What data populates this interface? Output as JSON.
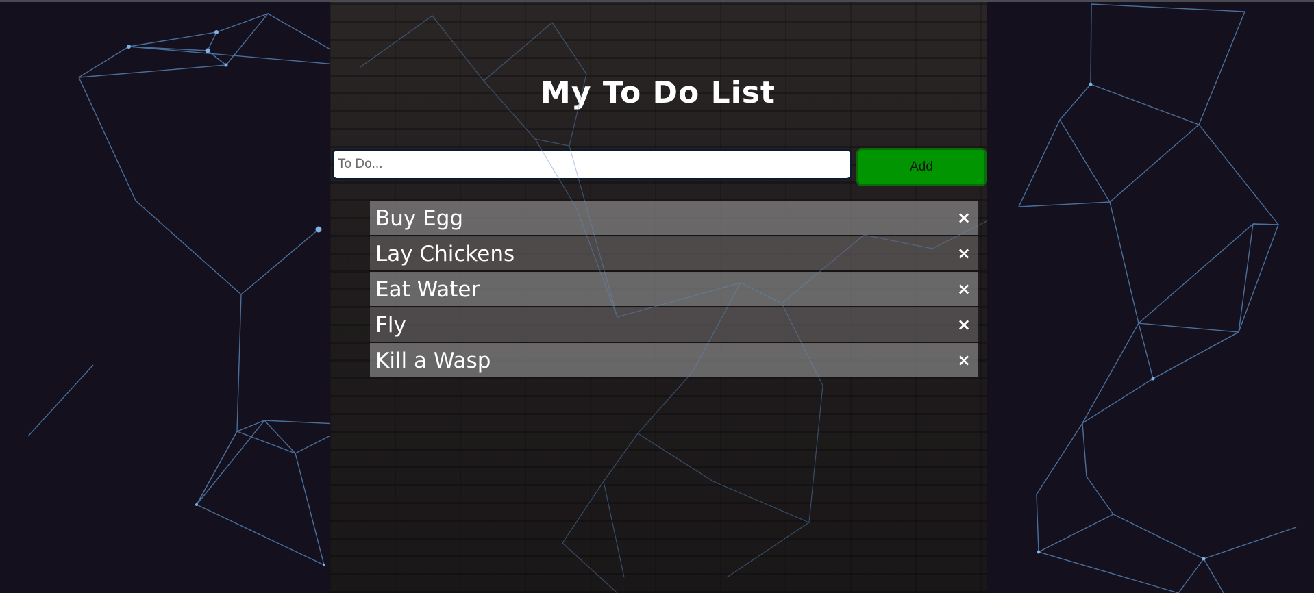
{
  "page": {
    "title": "My To Do List"
  },
  "form": {
    "input_placeholder": "To Do...",
    "input_value": "",
    "add_label": "Add"
  },
  "todos": [
    {
      "text": "Buy Egg",
      "delete_icon": "×"
    },
    {
      "text": "Lay Chickens",
      "delete_icon": "×"
    },
    {
      "text": "Eat Water",
      "delete_icon": "×"
    },
    {
      "text": "Fly",
      "delete_icon": "×"
    },
    {
      "text": "Kill a Wasp",
      "delete_icon": "×"
    }
  ],
  "colors": {
    "background": "#14101d",
    "network_lines": "#5b8fc7",
    "add_button": "#019601",
    "text": "#ffffff"
  }
}
